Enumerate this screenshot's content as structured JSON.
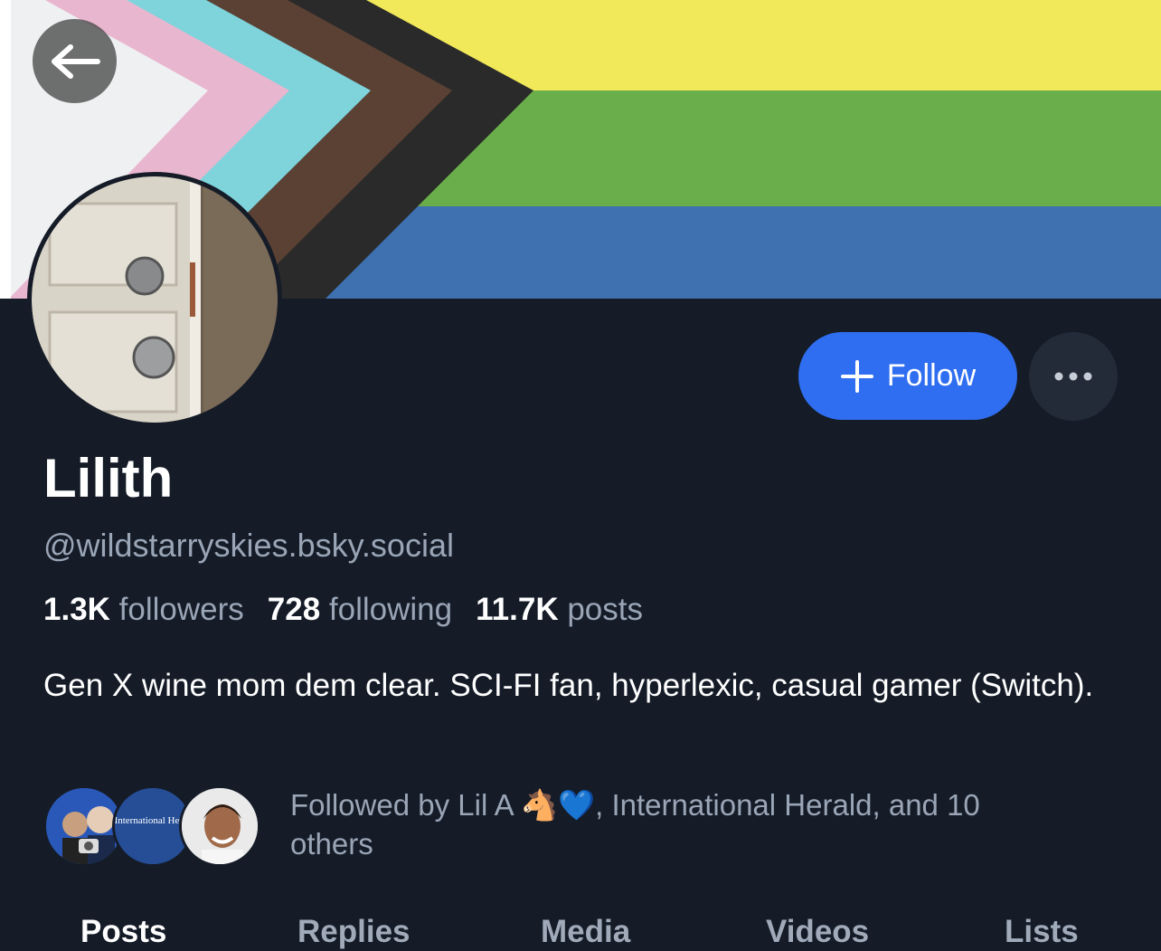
{
  "profile": {
    "display_name": "Lilith",
    "handle": "@wildstarryskies.bsky.social",
    "bio": "Gen X wine mom dem clear. SCI-FI fan, hyperlexic, casual gamer (Switch)."
  },
  "stats": {
    "followers_count": "1.3K",
    "followers_label": "followers",
    "following_count": "728",
    "following_label": "following",
    "posts_count": "11.7K",
    "posts_label": "posts"
  },
  "actions": {
    "follow_label": "Follow"
  },
  "followed_by": {
    "text": "Followed by Lil A 🐴💙, International Herald, and 10 others",
    "avatar_2_text": "International Herald"
  },
  "tabs": [
    {
      "label": "Posts",
      "active": true
    },
    {
      "label": "Replies",
      "active": false
    },
    {
      "label": "Media",
      "active": false
    },
    {
      "label": "Videos",
      "active": false
    },
    {
      "label": "Lists",
      "active": false
    }
  ],
  "colors": {
    "background": "#151c28",
    "accent": "#2f6ef0",
    "muted_text": "#9aa5b6"
  },
  "icons": {
    "back": "arrow-left-icon",
    "follow": "plus-icon",
    "more": "ellipsis-icon"
  }
}
